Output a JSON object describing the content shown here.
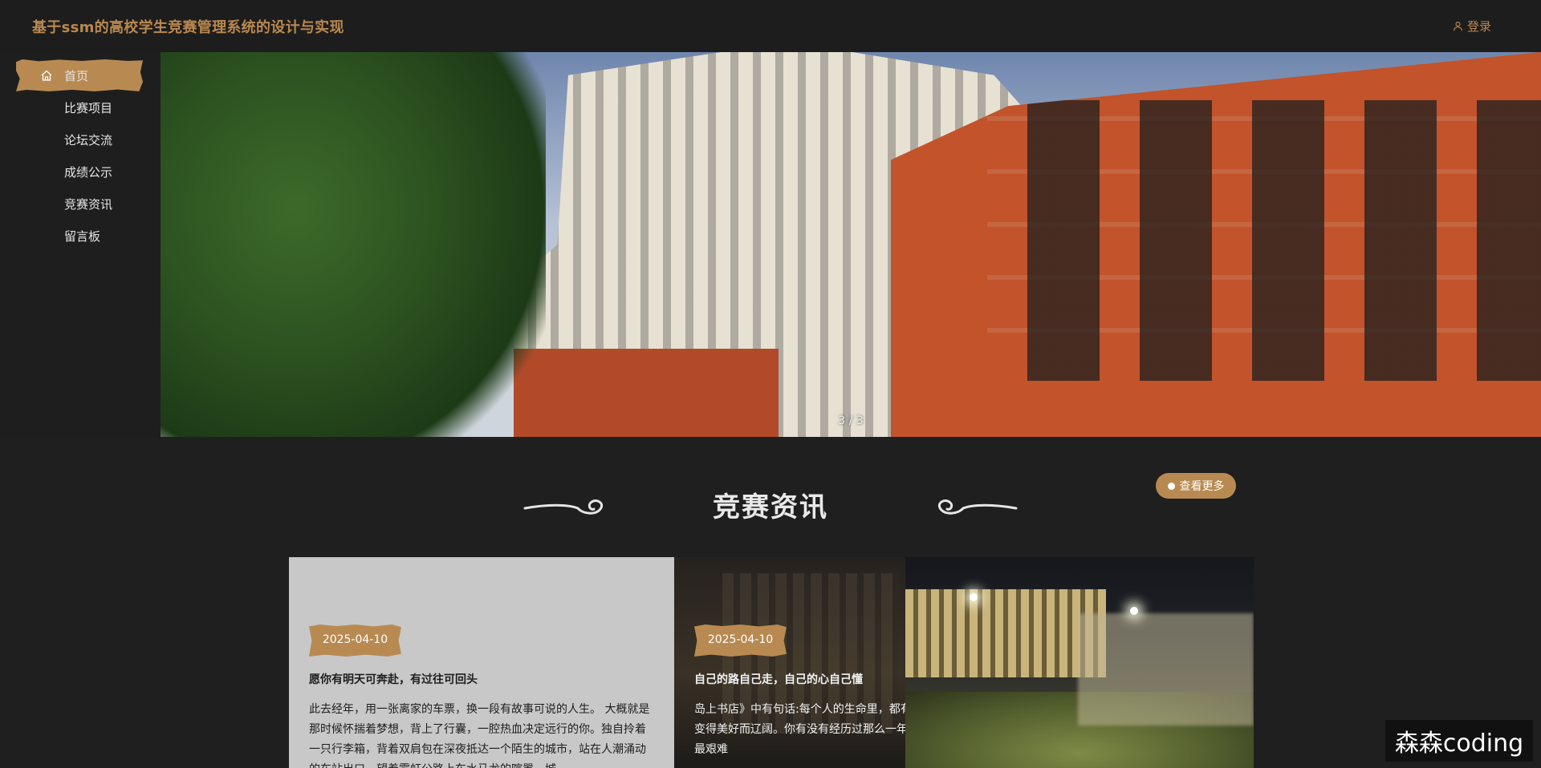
{
  "header": {
    "app_title": "基于ssm的高校学生竞赛管理系统的设计与实现",
    "login_label": "登录",
    "login_icon": "user-icon"
  },
  "sidebar": {
    "items": [
      {
        "label": "首页",
        "icon": "home-icon",
        "active": true
      },
      {
        "label": "比赛项目"
      },
      {
        "label": "论坛交流"
      },
      {
        "label": "成绩公示"
      },
      {
        "label": "竞赛资讯"
      },
      {
        "label": "留言板"
      }
    ]
  },
  "banner": {
    "pager": "3 / 3"
  },
  "news": {
    "section_title": "竞赛资讯",
    "more_label": "查看更多",
    "cards": [
      {
        "date": "2025-04-10",
        "title": "愿你有明天可奔赴，有过往可回头",
        "body": "此去经年，用一张离家的车票，换一段有故事可说的人生。 大概就是那时候怀揣着梦想，背上了行囊，一腔热血决定远行的你。独自拎着一只行李箱，背着双肩包在深夜抵达一个陌生的城市，站在人潮涌动的车站出口，望着霓虹公路上车水马龙的喧嚣，城"
      },
      {
        "date": "2025-04-10",
        "title": "自己的路自己走，自己的心自己懂",
        "body": "岛上书店》中有句话:每个人的生命里，都有最艰难的那一年，将人生变得美好而辽阔。你有没有经历过那么一年，在走过的岁月中跌过得最艰难"
      }
    ]
  },
  "watermark": "森森coding",
  "colors": {
    "accent": "#b88a52",
    "background": "#1f1f1f",
    "title": "#b9884f"
  }
}
